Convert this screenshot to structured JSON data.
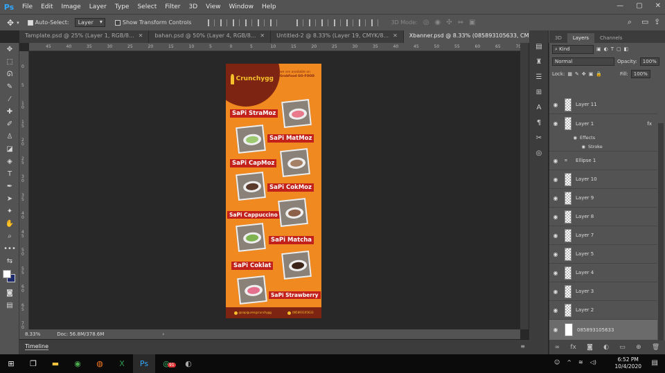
{
  "app": {
    "logo": "Ps"
  },
  "menu": [
    "File",
    "Edit",
    "Image",
    "Layer",
    "Type",
    "Select",
    "Filter",
    "3D",
    "View",
    "Window",
    "Help"
  ],
  "options": {
    "auto_select_label": "Auto-Select:",
    "auto_select_value": "Layer",
    "transform_label": "Show Transform Controls",
    "mode_label": "3D Mode:"
  },
  "tabs": [
    {
      "label": "Tamplate.psd @ 25% (Layer 1, RGB/8..."
    },
    {
      "label": "bahan.psd @ 50% (Layer 4, RGB/8..."
    },
    {
      "label": "Untitled-2 @ 8.33% (Layer 19, CMYK/8..."
    },
    {
      "label": "Xbanner.psd @ 8.33% (085893105633, CMYK/8#)"
    }
  ],
  "ruler_h": [
    "45",
    "40",
    "35",
    "30",
    "25",
    "20",
    "15",
    "10",
    "5",
    "0",
    "5",
    "10",
    "15",
    "20",
    "25",
    "30",
    "35",
    "40",
    "45",
    "50",
    "55",
    "60",
    "65",
    "70"
  ],
  "ruler_v": [
    "0",
    "5",
    "1 0",
    "1 5",
    "2 0",
    "2 5",
    "3 0",
    "3 5",
    "4 0",
    "4 5",
    "5 0",
    "5 5",
    "6 0",
    "6 5",
    "7 0"
  ],
  "banner": {
    "logo": "Crunchygg",
    "available": "we are available on",
    "delivery": "GrabFood  GO-FOOD",
    "products": [
      "SaPi StraMoz",
      "SaPi MatMoz",
      "SaPi CapMoz",
      "SaPi CokMoz",
      "SaPi Cappuccino",
      "SaPi Matcha",
      "SaPi Coklat",
      "SaPi Strawberry"
    ],
    "footer_ig": "@sapigurengcrunchygg",
    "footer_phone": "085893105633",
    "colors": {
      "bg": "#f0891f",
      "dark": "#7e2413",
      "label": "#c1201b",
      "gold": "#f6c12a"
    }
  },
  "status": {
    "zoom": "8.33%",
    "doc": "Doc: 56.8M/378.6M"
  },
  "timeline": "Timeline",
  "panel": {
    "tabs": [
      "3D",
      "Layers",
      "Channels"
    ],
    "kind": "Kind",
    "blend": "Normal",
    "opacity_label": "Opacity:",
    "opacity": "100%",
    "lock_label": "Lock:",
    "fill_label": "Fill:",
    "fill": "100%",
    "layers": [
      "Layer 11",
      "Layer 1",
      "Ellipse 1",
      "Layer 10",
      "Layer 9",
      "Layer 8",
      "Layer 7",
      "Layer 5",
      "Layer 4",
      "Layer 3",
      "Layer 2",
      "085893105633"
    ],
    "effects": "Effects",
    "stroke": "Stroke",
    "fx": "fx"
  },
  "taskbar": {
    "time": "6:52 PM",
    "date": "10/4/2020",
    "badge": "91"
  }
}
